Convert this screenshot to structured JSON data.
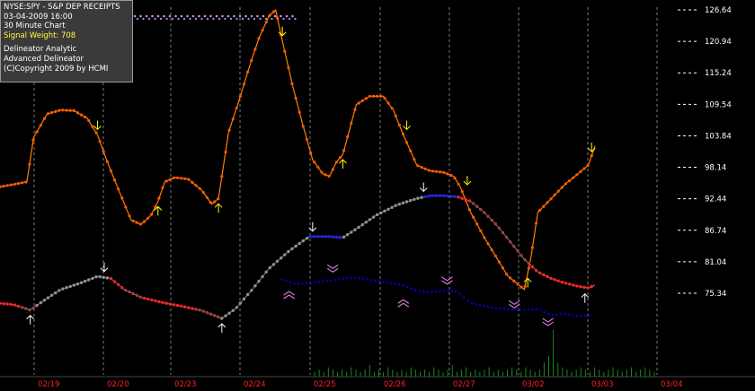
{
  "header": {
    "symbol_line": "NYSE:SPY - S&P DEP RECEIPTS",
    "datetime": "03-04-2009  16:00",
    "interval": "30 Minute Chart",
    "signal_weight": "Signal Weight: 708",
    "analytic": "Delineator Analytic",
    "product": "Advanced Delineator",
    "copyright": "(C)Copyright 2009 by  HCMI"
  },
  "colors": {
    "background": "#000000",
    "price": "#ff8000",
    "price_marker": "#ff5a00",
    "signal_up": "#909090",
    "signal_down": "#a04040",
    "signal_hot": "#ff2020",
    "signal_blue": "#2020ff",
    "secondary": "#0000e0",
    "volume": "#1a8a1a",
    "arrow_yellow": "#ffff00",
    "arrow_white": "#ffffff",
    "chevron": "#e080e0",
    "date_label": "#ff2020",
    "axis_text": "#ffffff"
  },
  "chart_data": {
    "type": "line",
    "title": "NYSE:SPY - S&P DEP RECEIPTS",
    "x_ticks": [
      "02/19",
      "02/20",
      "02/23",
      "02/24",
      "02/25",
      "02/26",
      "02/27",
      "03/02",
      "03/03",
      "03/04"
    ],
    "y_ticks": [
      126.64,
      120.94,
      115.24,
      109.54,
      103.84,
      98.14,
      92.44,
      86.74,
      81.04,
      75.34
    ],
    "y_tick_labels": [
      "126.64",
      "120.94",
      "115.24",
      "109.54",
      "103.84",
      "98.14",
      "92.44",
      "86.74",
      "81.04",
      "75.34"
    ],
    "ylim": [
      68.0,
      130.0
    ],
    "xlim": [
      0,
      100
    ],
    "grid": "vertical dotted session lines",
    "series": [
      {
        "role": "price",
        "points": [
          [
            0,
            94.6
          ],
          [
            4,
            95.5
          ],
          [
            5,
            103.5
          ],
          [
            7,
            107.8
          ],
          [
            9,
            108.5
          ],
          [
            11,
            108.4
          ],
          [
            13,
            107.0
          ],
          [
            14.5,
            104.0
          ],
          [
            16,
            99.0
          ],
          [
            18,
            93.0
          ],
          [
            19.5,
            88.6
          ],
          [
            21,
            87.8
          ],
          [
            22.5,
            89.5
          ],
          [
            23.5,
            92.0
          ],
          [
            24.5,
            95.5
          ],
          [
            26,
            96.3
          ],
          [
            28,
            96.0
          ],
          [
            30,
            94.0
          ],
          [
            31.5,
            91.5
          ],
          [
            32.5,
            92.5
          ],
          [
            34,
            104.5
          ],
          [
            35.5,
            110.0
          ],
          [
            37,
            116.0
          ],
          [
            38.5,
            121.5
          ],
          [
            40,
            125.5
          ],
          [
            41,
            126.64
          ],
          [
            42,
            121.0
          ],
          [
            43.5,
            113.0
          ],
          [
            45,
            106.0
          ],
          [
            46.5,
            99.5
          ],
          [
            48,
            97.0
          ],
          [
            49,
            96.5
          ],
          [
            50,
            99.0
          ],
          [
            51,
            100.5
          ],
          [
            52,
            105.0
          ],
          [
            53,
            109.5
          ],
          [
            55,
            111.0
          ],
          [
            57,
            111.0
          ],
          [
            58.5,
            108.5
          ],
          [
            60,
            104.0
          ],
          [
            62,
            98.5
          ],
          [
            64,
            97.5
          ],
          [
            66,
            97.2
          ],
          [
            67.5,
            96.5
          ],
          [
            68.5,
            94.5
          ],
          [
            70,
            90.0
          ],
          [
            72,
            85.5
          ],
          [
            74,
            81.5
          ],
          [
            75.5,
            78.5
          ],
          [
            77,
            77.0
          ],
          [
            78,
            76.0
          ],
          [
            79,
            82.0
          ],
          [
            80,
            90.0
          ],
          [
            82,
            92.5
          ],
          [
            84,
            95.0
          ],
          [
            86,
            97.0
          ],
          [
            87.5,
            98.5
          ],
          [
            88.5,
            102.0
          ]
        ]
      },
      {
        "role": "signal",
        "points": [
          [
            0,
            73.5
          ],
          [
            2,
            73.3
          ],
          [
            4.5,
            72.3
          ],
          [
            6.5,
            74.0
          ],
          [
            9,
            76.0
          ],
          [
            12,
            77.2
          ],
          [
            14.5,
            78.4
          ],
          [
            16.5,
            78.0
          ],
          [
            18.5,
            76.0
          ],
          [
            21,
            74.6
          ],
          [
            24,
            73.7
          ],
          [
            27,
            73.0
          ],
          [
            30,
            72.2
          ],
          [
            33,
            70.8
          ],
          [
            35,
            72.5
          ],
          [
            37.5,
            76.0
          ],
          [
            40,
            79.8
          ],
          [
            43,
            83.0
          ],
          [
            46,
            85.6
          ],
          [
            49,
            85.6
          ],
          [
            51,
            85.4
          ],
          [
            53,
            87.0
          ],
          [
            56,
            89.5
          ],
          [
            59,
            91.3
          ],
          [
            62,
            92.5
          ],
          [
            64,
            93.0
          ],
          [
            66,
            93.0
          ],
          [
            68,
            92.8
          ],
          [
            70,
            92.0
          ],
          [
            72,
            90.0
          ],
          [
            74,
            87.5
          ],
          [
            76,
            84.5
          ],
          [
            78,
            81.5
          ],
          [
            80,
            79.2
          ],
          [
            82,
            78.0
          ],
          [
            84,
            77.2
          ],
          [
            86,
            76.6
          ],
          [
            87.5,
            76.3
          ],
          [
            88.5,
            76.8
          ]
        ]
      },
      {
        "role": "secondary",
        "points": [
          [
            42,
            77.8
          ],
          [
            44,
            77.0
          ],
          [
            46,
            77.2
          ],
          [
            48,
            77.5
          ],
          [
            50,
            77.8
          ],
          [
            52,
            78.2
          ],
          [
            54,
            78.0
          ],
          [
            56,
            77.6
          ],
          [
            58,
            77.2
          ],
          [
            60,
            76.8
          ],
          [
            62,
            75.8
          ],
          [
            64,
            75.5
          ],
          [
            66,
            75.8
          ],
          [
            68,
            75.6
          ],
          [
            70,
            73.6
          ],
          [
            72,
            73.0
          ],
          [
            74,
            72.6
          ],
          [
            76,
            72.4
          ],
          [
            78,
            72.3
          ],
          [
            80,
            72.5
          ],
          [
            82,
            71.4
          ],
          [
            84,
            71.6
          ],
          [
            86,
            71.2
          ],
          [
            88,
            71.4
          ]
        ]
      }
    ],
    "volume": [
      2,
      3,
      2,
      4,
      3,
      2,
      3,
      2,
      4,
      3,
      2,
      3,
      5,
      2,
      3,
      2,
      4,
      3,
      2,
      3,
      2,
      4,
      3,
      2,
      3,
      2,
      4,
      3,
      2,
      3,
      5,
      2,
      3,
      4,
      2,
      3,
      2,
      3,
      4,
      2,
      3,
      2,
      3,
      4,
      3,
      2,
      4,
      3,
      2,
      3,
      6,
      9,
      20,
      6,
      4,
      3,
      2,
      3,
      4,
      3,
      2,
      4,
      3,
      2,
      3,
      4,
      3,
      2,
      3,
      4,
      2,
      3,
      4,
      3,
      2
    ],
    "markers": [
      {
        "kind": "down",
        "color": "yellow",
        "x": 14.5,
        "y": 104.0
      },
      {
        "kind": "up",
        "color": "yellow",
        "x": 23.5,
        "y": 92.0
      },
      {
        "kind": "up",
        "color": "yellow",
        "x": 32.5,
        "y": 92.5
      },
      {
        "kind": "down",
        "color": "yellow",
        "x": 42.0,
        "y": 121.0
      },
      {
        "kind": "up",
        "color": "yellow",
        "x": 51.0,
        "y": 100.5
      },
      {
        "kind": "down",
        "color": "yellow",
        "x": 60.5,
        "y": 104.0
      },
      {
        "kind": "down",
        "color": "yellow",
        "x": 69.5,
        "y": 94.0
      },
      {
        "kind": "up",
        "color": "yellow",
        "x": 78.5,
        "y": 79.0
      },
      {
        "kind": "down",
        "color": "yellow",
        "x": 88.0,
        "y": 100.0
      },
      {
        "kind": "up",
        "color": "white",
        "x": 4.5,
        "y": 72.3
      },
      {
        "kind": "down",
        "color": "white",
        "x": 15.5,
        "y": 78.3
      },
      {
        "kind": "up",
        "color": "white",
        "x": 33.0,
        "y": 70.8
      },
      {
        "kind": "down",
        "color": "white",
        "x": 46.5,
        "y": 85.6
      },
      {
        "kind": "down",
        "color": "white",
        "x": 63.0,
        "y": 92.8
      },
      {
        "kind": "up",
        "color": "white",
        "x": 87.0,
        "y": 76.2
      },
      {
        "kind": "chev-up",
        "color": "pink",
        "x": 43.0,
        "y": 75.5
      },
      {
        "kind": "chev-down",
        "color": "pink",
        "x": 49.5,
        "y": 80.0
      },
      {
        "kind": "chev-up",
        "color": "pink",
        "x": 60.0,
        "y": 74.0
      },
      {
        "kind": "chev-down",
        "color": "pink",
        "x": 66.5,
        "y": 77.8
      },
      {
        "kind": "chev-down",
        "color": "pink",
        "x": 76.5,
        "y": 73.5
      },
      {
        "kind": "chev-down",
        "color": "pink",
        "x": 81.5,
        "y": 70.3
      }
    ]
  }
}
